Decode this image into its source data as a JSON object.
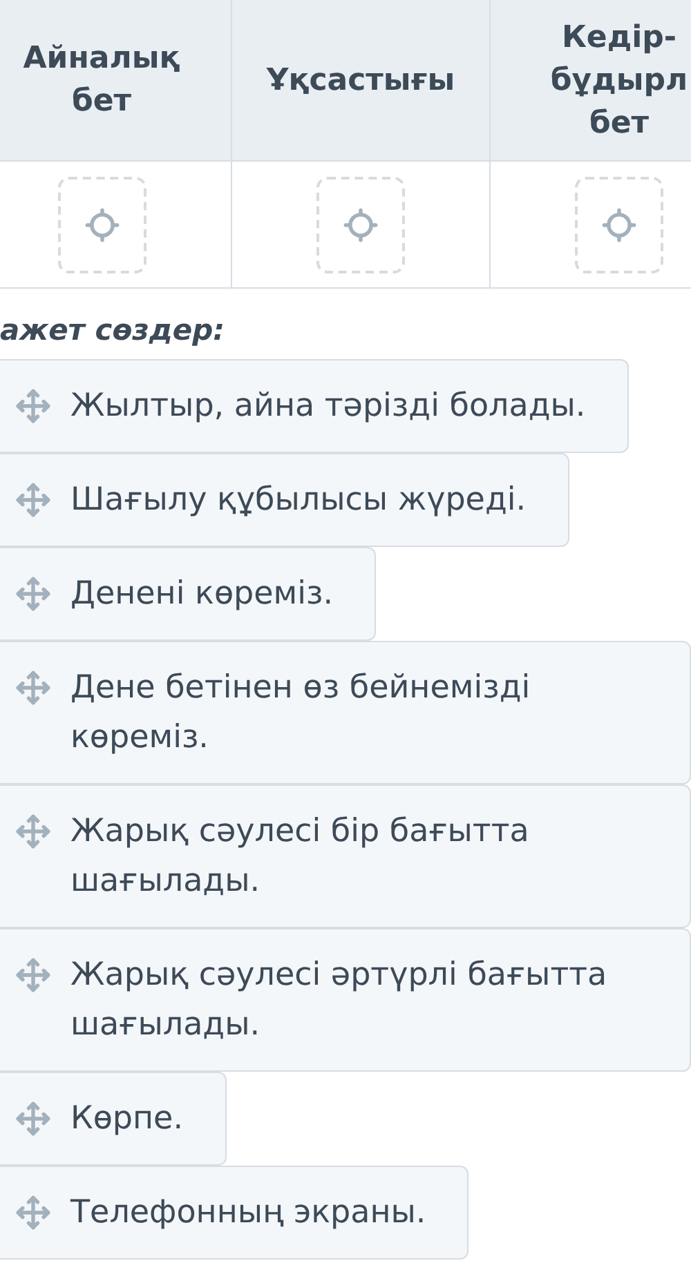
{
  "table": {
    "columns": [
      {
        "header": "Айналық\nбет"
      },
      {
        "header": "Ұқсастығы"
      },
      {
        "header": "Кедір-\nбұдырл\nбет"
      }
    ],
    "drop_zones": [
      {
        "kind": "empty"
      },
      {
        "kind": "empty"
      },
      {
        "kind": "empty"
      }
    ]
  },
  "word_bank": {
    "heading": "ажет сөздер:",
    "items": [
      {
        "text": "Жылтыр, айна тәрізді болады."
      },
      {
        "text": "Шағылу құбылысы жүреді."
      },
      {
        "text": "Денені көреміз."
      },
      {
        "text": "Дене бетінен өз бейнемізді көреміз."
      },
      {
        "text": "Жарық сәулесі бір бағытта шағылады."
      },
      {
        "text": "Жарық сәулесі әртүрлі бағытта шағылады."
      },
      {
        "text": "Көрпе."
      },
      {
        "text": "Телефонның экраны."
      }
    ]
  }
}
